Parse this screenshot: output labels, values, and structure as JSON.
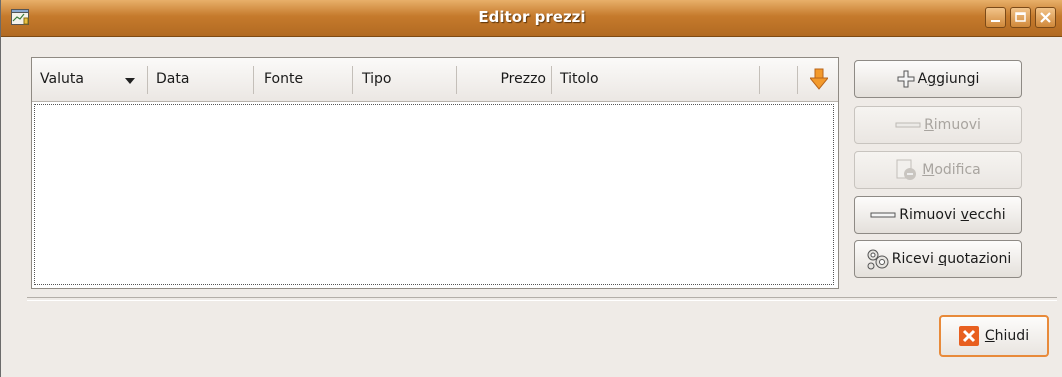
{
  "window": {
    "title": "Editor prezzi"
  },
  "table": {
    "columns": [
      {
        "label": "Valuta"
      },
      {
        "label": "Data"
      },
      {
        "label": "Fonte"
      },
      {
        "label": "Tipo"
      },
      {
        "label": "Prezzo"
      },
      {
        "label": "Titolo"
      }
    ],
    "sort_icon": "arrow-down-icon",
    "rows": []
  },
  "buttons": {
    "add": {
      "pre": "A",
      "u": "g",
      "post": "giungi",
      "icon": "plus-icon",
      "enabled": true
    },
    "remove": {
      "pre": "",
      "u": "R",
      "post": "imuovi",
      "icon": "minus-icon",
      "enabled": false
    },
    "edit": {
      "pre": "",
      "u": "M",
      "post": "odifica",
      "icon": "edit-icon",
      "enabled": false
    },
    "remove_old": {
      "pre": "Rimuovi ",
      "u": "v",
      "post": "ecchi",
      "icon": "minus-icon",
      "enabled": true
    },
    "get_quotes": {
      "pre": "Ricevi ",
      "u": "q",
      "post": "uotazioni",
      "icon": "gears-icon",
      "enabled": true
    },
    "close": {
      "pre": "",
      "u": "C",
      "post": "hiudi",
      "icon": "close-icon",
      "enabled": true
    }
  },
  "colors": {
    "accent": "#e88a3a",
    "titlebar": "#c57a2c"
  }
}
